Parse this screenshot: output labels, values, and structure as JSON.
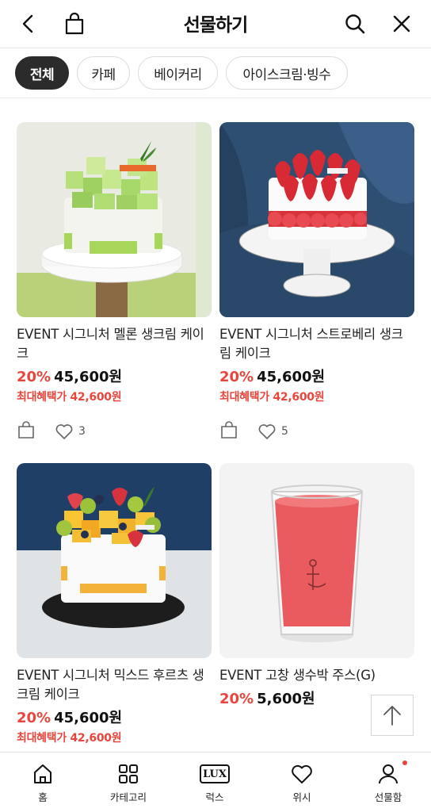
{
  "header": {
    "title": "선물하기",
    "back_icon": "chevron-left-icon",
    "bag_icon": "shopping-bag-icon",
    "search_icon": "search-icon",
    "close_icon": "close-icon"
  },
  "categories": [
    {
      "label": "전체",
      "active": true
    },
    {
      "label": "카페",
      "active": false
    },
    {
      "label": "베이커리",
      "active": false
    },
    {
      "label": "아이스크림·빙수",
      "active": false
    }
  ],
  "products": [
    {
      "name": "EVENT 시그니처 멜론 생크림 케이크",
      "discount": "20%",
      "price": "45,600원",
      "benefit": "최대혜택가 42,600원",
      "likes": "3",
      "image": "melon-cake"
    },
    {
      "name": "EVENT 시그니처 스트로베리 생크림 케이크",
      "discount": "20%",
      "price": "45,600원",
      "benefit": "최대혜택가 42,600원",
      "likes": "5",
      "image": "strawberry-cake"
    },
    {
      "name": "EVENT 시그니처 믹스드 후르츠 생크림 케이크",
      "discount": "20%",
      "price": "45,600원",
      "benefit": "최대혜택가 42,600원",
      "image": "mixed-fruit-cake"
    },
    {
      "name": "EVENT 고창 생수박 주스(G)",
      "discount": "20%",
      "price": "5,600원",
      "image": "watermelon-juice"
    }
  ],
  "scroll_top_icon": "arrow-up-icon",
  "bottom_nav": [
    {
      "label": "홈",
      "icon": "home-icon"
    },
    {
      "label": "카테고리",
      "icon": "grid-icon"
    },
    {
      "label": "럭스",
      "icon": "lux-icon",
      "badge_text": "LUX"
    },
    {
      "label": "위시",
      "icon": "heart-icon"
    },
    {
      "label": "선물함",
      "icon": "user-icon",
      "has_dot": true
    }
  ],
  "colors": {
    "accent": "#e8453c",
    "chip_active": "#2b2b2b"
  }
}
